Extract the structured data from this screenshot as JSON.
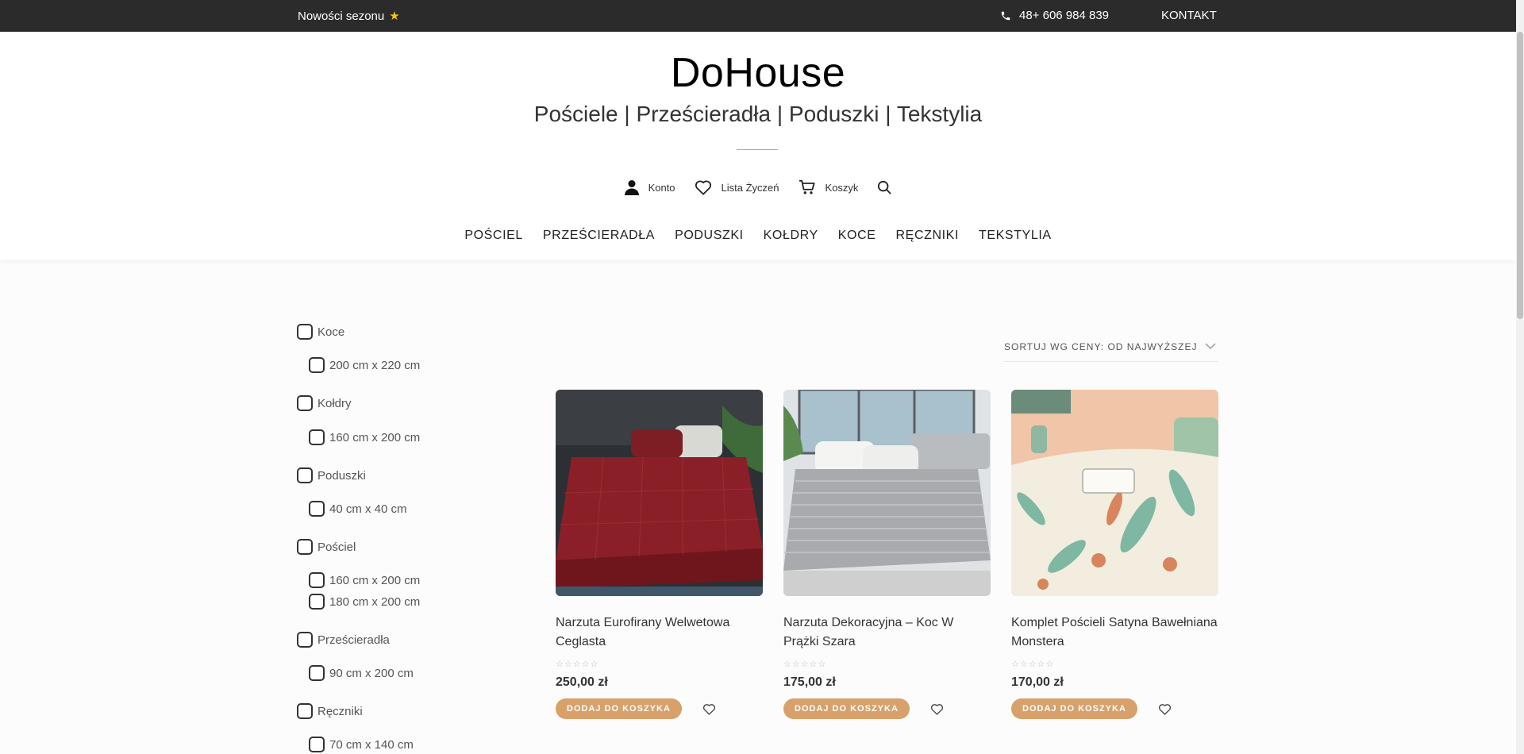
{
  "topbar": {
    "promo": "Nowości sezonu",
    "promo_icon": "star-icon",
    "phone": "48+ 606 984 839",
    "contact": "KONTAKT"
  },
  "header": {
    "logo": "DoHouse",
    "tagline": "Pościele | Prześcieradła | Poduszki | Tekstylia",
    "account": "Konto",
    "wishlist": "Lista Życzeń",
    "cart": "Koszyk"
  },
  "nav": [
    "POŚCIEL",
    "PRZEŚCIERADŁA",
    "PODUSZKI",
    "KOŁDRY",
    "KOCE",
    "RĘCZNIKI",
    "TEKSTYLIA"
  ],
  "filters": [
    {
      "label": "Koce",
      "sub": [
        "200 cm x 220 cm"
      ]
    },
    {
      "label": "Kołdry",
      "sub": [
        "160 cm x 200 cm"
      ]
    },
    {
      "label": "Poduszki",
      "sub": [
        "40 cm x 40 cm"
      ]
    },
    {
      "label": "Pościel",
      "sub": [
        "160 cm x 200 cm",
        "180 cm x 200 cm"
      ]
    },
    {
      "label": "Prześcieradła",
      "sub": [
        "90 cm x 200 cm"
      ]
    },
    {
      "label": "Ręczniki",
      "sub": [
        "70 cm x 140 cm"
      ]
    }
  ],
  "sort": {
    "label": "SORTUJ WG CENY: OD NAJWYŻSZEJ"
  },
  "products": [
    {
      "title": "Narzuta Eurofirany Welwetowa Ceglasta",
      "price": "250,00 zł",
      "button": "DODAJ DO KOSZYKA",
      "rating": 0
    },
    {
      "title": "Narzuta Dekoracyjna – Koc W Prążki Szara",
      "price": "175,00 zł",
      "button": "DODAJ DO KOSZYKA",
      "rating": 0
    },
    {
      "title": "Komplet Pościeli Satyna Bawełniana Monstera",
      "price": "170,00 zł",
      "button": "DODAJ DO KOSZYKA",
      "rating": 0
    }
  ],
  "colors": {
    "accent": "#d8a06a",
    "topbar": "#2b2b2b"
  }
}
